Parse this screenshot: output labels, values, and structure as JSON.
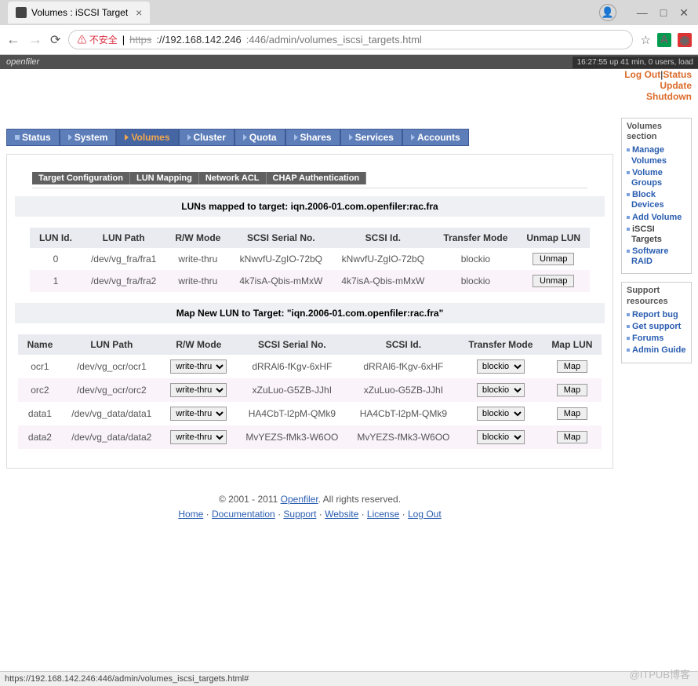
{
  "browser": {
    "tab_title": "Volumes : iSCSI Target",
    "url_warn_icon": "⚠",
    "url_warn_text": "不安全",
    "url_scheme": "https",
    "url_host": "://192.168.142.246",
    "url_path": ":446/admin/volumes_iscsi_targets.html",
    "statusbar": "https://192.168.142.246:446/admin/volumes_iscsi_targets.html#",
    "win_min": "—",
    "win_max": "□",
    "win_close": "✕"
  },
  "header": {
    "brand": "openfiler",
    "uptime": "16:27:55 up 41 min, 0 users, load",
    "links": {
      "logout": "Log Out",
      "status": "Status",
      "update": "Update",
      "shutdown": "Shutdown"
    }
  },
  "nav": {
    "status": "Status",
    "system": "System",
    "volumes": "Volumes",
    "cluster": "Cluster",
    "quota": "Quota",
    "shares": "Shares",
    "services": "Services",
    "accounts": "Accounts"
  },
  "subtabs": {
    "target_config": "Target Configuration",
    "lun_mapping": "LUN Mapping",
    "network_acl": "Network ACL",
    "chap_auth": "CHAP Authentication"
  },
  "mapped": {
    "title": "LUNs mapped to target: iqn.2006-01.com.openfiler:rac.fra",
    "headers": {
      "lun_id": "LUN Id.",
      "lun_path": "LUN Path",
      "rw_mode": "R/W Mode",
      "serial": "SCSI Serial No.",
      "scsi_id": "SCSI Id.",
      "transfer": "Transfer Mode",
      "unmap": "Unmap LUN"
    },
    "rows": [
      {
        "id": "0",
        "path": "/dev/vg_fra/fra1",
        "rw": "write-thru",
        "serial": "kNwvfU-ZgIO-72bQ",
        "scsi": "kNwvfU-ZgIO-72bQ",
        "transfer": "blockio",
        "btn": "Unmap"
      },
      {
        "id": "1",
        "path": "/dev/vg_fra/fra2",
        "rw": "write-thru",
        "serial": "4k7isA-Qbis-mMxW",
        "scsi": "4k7isA-Qbis-mMxW",
        "transfer": "blockio",
        "btn": "Unmap"
      }
    ]
  },
  "mapnew": {
    "title": "Map New LUN to Target: \"iqn.2006-01.com.openfiler:rac.fra\"",
    "headers": {
      "name": "Name",
      "lun_path": "LUN Path",
      "rw_mode": "R/W Mode",
      "serial": "SCSI Serial No.",
      "scsi_id": "SCSI Id.",
      "transfer": "Transfer Mode",
      "map": "Map LUN"
    },
    "rows": [
      {
        "name": "ocr1",
        "path": "/dev/vg_ocr/ocr1",
        "rw": "write-thru",
        "serial": "dRRAl6-fKgv-6xHF",
        "scsi": "dRRAl6-fKgv-6xHF",
        "transfer": "blockio",
        "btn": "Map"
      },
      {
        "name": "orc2",
        "path": "/dev/vg_ocr/orc2",
        "rw": "write-thru",
        "serial": "xZuLuo-G5ZB-JJhI",
        "scsi": "xZuLuo-G5ZB-JJhI",
        "transfer": "blockio",
        "btn": "Map"
      },
      {
        "name": "data1",
        "path": "/dev/vg_data/data1",
        "rw": "write-thru",
        "serial": "HA4CbT-l2pM-QMk9",
        "scsi": "HA4CbT-l2pM-QMk9",
        "transfer": "blockio",
        "btn": "Map"
      },
      {
        "name": "data2",
        "path": "/dev/vg_data/data2",
        "rw": "write-thru",
        "serial": "MvYEZS-fMk3-W6OO",
        "scsi": "MvYEZS-fMk3-W6OO",
        "transfer": "blockio",
        "btn": "Map"
      }
    ]
  },
  "sidebar": {
    "vol_title": "Volumes section",
    "vol_links": {
      "manage": "Manage Volumes",
      "groups": "Volume Groups",
      "block": "Block Devices",
      "add": "Add Volume",
      "iscsi": "iSCSI Targets",
      "raid": "Software RAID"
    },
    "sup_title": "Support resources",
    "sup_links": {
      "report": "Report bug",
      "getsup": "Get support",
      "forums": "Forums",
      "admin": "Admin Guide"
    }
  },
  "footer": {
    "copyright_pre": "© 2001 - 2011 ",
    "openfiler": "Openfiler",
    "copyright_post": ". All rights reserved.",
    "home": "Home",
    "docs": "Documentation",
    "support": "Support",
    "website": "Website",
    "license": "License",
    "logout": "Log Out",
    "sep": " · "
  },
  "watermark": "@ITPUB博客"
}
